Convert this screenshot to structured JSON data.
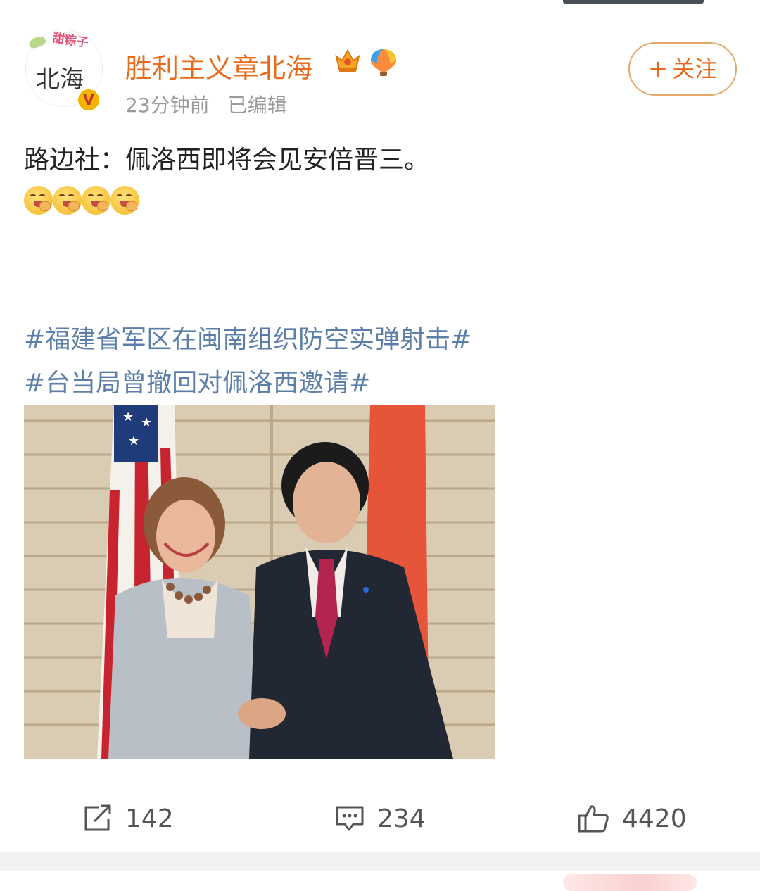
{
  "post": {
    "avatar": {
      "text": "北海",
      "deco_text": "甜粽子",
      "verified_mark": "V"
    },
    "username": "胜利主义章北海",
    "timestamp": "23分钟前",
    "edited_label": "已编辑",
    "follow_button": {
      "plus": "+",
      "label": "关注"
    },
    "text": "路边社：佩洛西即将会见安倍晋三。",
    "emoji_count": 4,
    "hashtags": [
      "#福建省军区在闽南组织防空实弹射击#",
      "#台当局曾撤回对佩洛西邀请#"
    ],
    "actions": {
      "repost_count": "142",
      "comment_count": "234",
      "like_count": "4420"
    }
  },
  "colors": {
    "username": "#e86b1c",
    "hashtag": "#5b7fa8",
    "meta_text": "#9a9a9a",
    "follow_border": "#e3a86a"
  },
  "icons": {
    "repost": "repost-icon",
    "comment": "comment-icon",
    "like": "thumbs-up-icon",
    "badge_1": "crown-badge-icon",
    "badge_2": "hot-air-balloon-badge-icon"
  }
}
